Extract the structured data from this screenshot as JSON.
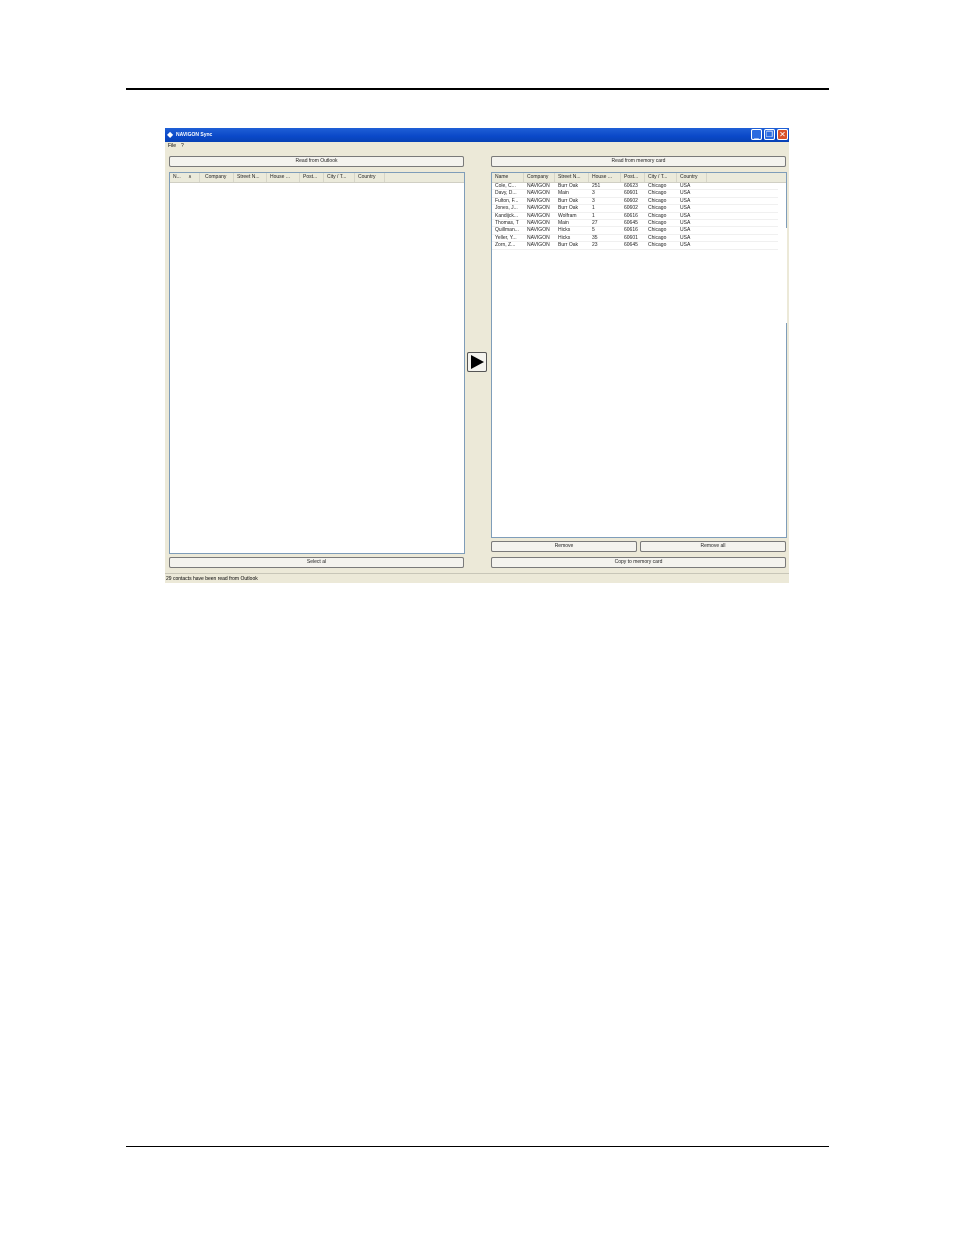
{
  "window": {
    "title": "NAVIGON Sync",
    "icon": "navigon-logo-icon",
    "minimize_glyph": "_",
    "maximize_glyph": "❐",
    "close_glyph": "✕"
  },
  "menu": [
    "File",
    "?"
  ],
  "left_panel": {
    "read_button": "Read from Outlook",
    "columns": [
      "N...",
      "Company",
      "Street N...",
      "House ...",
      "Post...",
      "City / T...",
      "Country"
    ],
    "sort_indicator": "∧",
    "rows": [],
    "select_all_button": "Select al"
  },
  "transfer": {
    "icon": "play-arrow-icon"
  },
  "right_panel": {
    "read_button": "Read from memory card",
    "columns": [
      "Name",
      "Company",
      "Street N...",
      "House ...",
      "Post...",
      "City / T...",
      "Country"
    ],
    "rows": [
      [
        "Cole, C...",
        "NAVIGON",
        "Burr Oak",
        "251",
        "60623",
        "Chicago",
        "USA"
      ],
      [
        "Davy, D...",
        "NAVIGON",
        "Main",
        "3",
        "60601",
        "Chicago",
        "USA"
      ],
      [
        "Fulton, F...",
        "NAVIGON",
        "Burr Oak",
        "3",
        "60602",
        "Chicago",
        "USA"
      ],
      [
        "Jones, J...",
        "NAVIGON",
        "Burr Oak",
        "1",
        "60602",
        "Chicago",
        "USA"
      ],
      [
        "Kandijck...",
        "NAVIGON",
        "Wolfram",
        "1",
        "60616",
        "Chicago",
        "USA"
      ],
      [
        "Thomas, T",
        "NAVIGON",
        "Main",
        "27",
        "60645",
        "Chicago",
        "USA"
      ],
      [
        "Quillman...",
        "NAVIGON",
        "Hicks",
        "5",
        "60616",
        "Chicago",
        "USA"
      ],
      [
        "Yeller, Y...",
        "NAVIGON",
        "Hicks",
        "35",
        "60601",
        "Chicago",
        "USA"
      ],
      [
        "Zorn, Z...",
        "NAVIGON",
        "Burr Oak",
        "23",
        "60645",
        "Chicago",
        "USA"
      ]
    ],
    "remove_button": "Remove",
    "remove_all_button": "Remove all",
    "copy_button": "Copy to memory card"
  },
  "status": "29 contacts have been read from Outlook"
}
